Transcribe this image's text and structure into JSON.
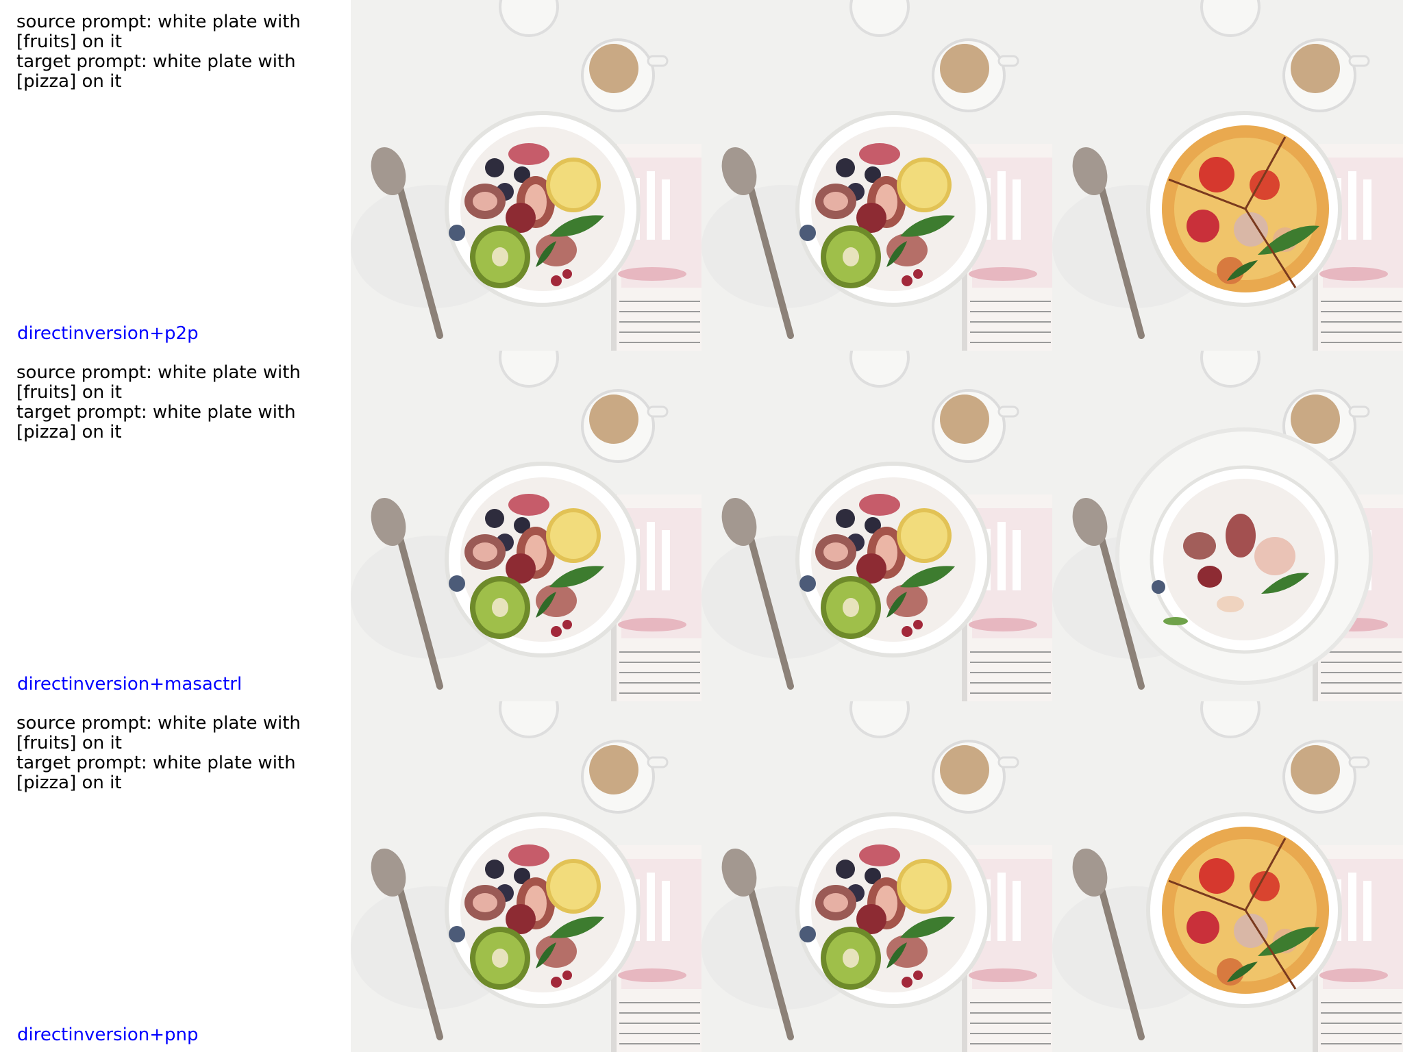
{
  "rows": [
    {
      "source_prompt": "source prompt: white plate with [fruits] on it",
      "target_prompt": "target prompt: white plate with [pizza] on it",
      "method": "directinversion+p2p",
      "tiles": [
        "source-image",
        "reconstruction-image",
        "edited-image-pizza"
      ]
    },
    {
      "source_prompt": "source prompt: white plate with [fruits] on it",
      "target_prompt": "target prompt: white plate with [pizza] on it",
      "method": "directinversion+masactrl",
      "tiles": [
        "source-image",
        "reconstruction-image",
        "edited-image-partial"
      ]
    },
    {
      "source_prompt": "source prompt: white plate with [fruits] on it",
      "target_prompt": "target prompt: white plate with [pizza] on it",
      "method": "directinversion+pnp",
      "tiles": [
        "source-image",
        "reconstruction-image",
        "edited-image-pizza"
      ]
    }
  ],
  "colors": {
    "method_label": "#0000ff",
    "prompt_text": "#000000",
    "background": "#ffffff"
  }
}
